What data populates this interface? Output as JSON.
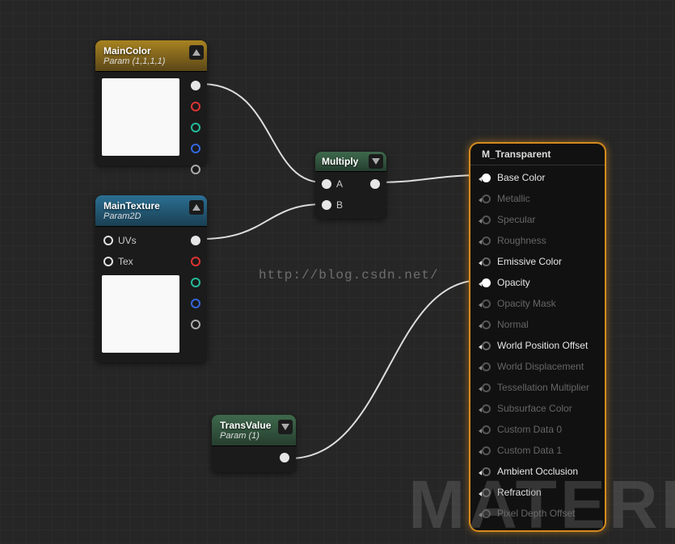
{
  "watermark_url": "http://blog.csdn.net/",
  "watermark_big": "MATERI",
  "nodes": {
    "maincolor": {
      "title": "MainColor",
      "subtitle": "Param (1,1,1,1)"
    },
    "maintexture": {
      "title": "MainTexture",
      "subtitle": "Param2D",
      "pin_uvs": "UVs",
      "pin_tex": "Tex"
    },
    "multiply": {
      "title": "Multiply",
      "pin_a": "A",
      "pin_b": "B"
    },
    "transvalue": {
      "title": "TransValue",
      "subtitle": "Param (1)"
    }
  },
  "result": {
    "title": "M_Transparent",
    "pins": [
      {
        "label": "Base Color",
        "enabled": true,
        "connected": true
      },
      {
        "label": "Metallic",
        "enabled": false,
        "connected": false
      },
      {
        "label": "Specular",
        "enabled": false,
        "connected": false
      },
      {
        "label": "Roughness",
        "enabled": false,
        "connected": false
      },
      {
        "label": "Emissive Color",
        "enabled": true,
        "connected": false
      },
      {
        "label": "Opacity",
        "enabled": true,
        "connected": true
      },
      {
        "label": "Opacity Mask",
        "enabled": false,
        "connected": false
      },
      {
        "label": "Normal",
        "enabled": false,
        "connected": false
      },
      {
        "label": "World Position Offset",
        "enabled": true,
        "connected": false
      },
      {
        "label": "World Displacement",
        "enabled": false,
        "connected": false
      },
      {
        "label": "Tessellation Multiplier",
        "enabled": false,
        "connected": false
      },
      {
        "label": "Subsurface Color",
        "enabled": false,
        "connected": false
      },
      {
        "label": "Custom Data 0",
        "enabled": false,
        "connected": false
      },
      {
        "label": "Custom Data 1",
        "enabled": false,
        "connected": false
      },
      {
        "label": "Ambient Occlusion",
        "enabled": true,
        "connected": false
      },
      {
        "label": "Refraction",
        "enabled": true,
        "connected": false
      },
      {
        "label": "Pixel Depth Offset",
        "enabled": false,
        "connected": false
      }
    ]
  }
}
